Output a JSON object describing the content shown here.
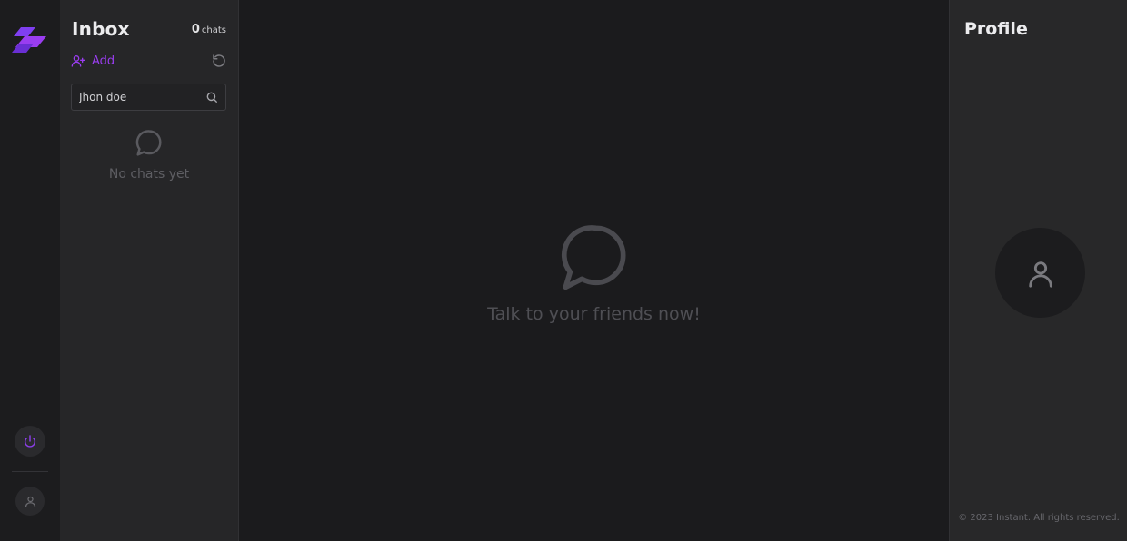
{
  "colors": {
    "accent": "#9a3df0",
    "rail_bg": "#1c1c1e",
    "panel_bg": "#262628",
    "main_bg": "#1b1b1d",
    "profile_bg": "#282829"
  },
  "rail": {
    "logo_icon": "brand-logo-icon",
    "power_icon": "power-icon",
    "avatar_icon": "user-icon"
  },
  "inbox": {
    "title": "Inbox",
    "count": "0",
    "count_label": "chats",
    "add_label": "Add",
    "add_icon": "user-plus-icon",
    "refresh_icon": "refresh-icon",
    "search": {
      "value": "Jhon doe",
      "icon": "search-icon"
    },
    "empty_text": "No chats yet",
    "empty_icon": "chat-bubble-icon"
  },
  "main": {
    "empty_text": "Talk to your friends now!",
    "empty_icon": "chat-bubble-icon"
  },
  "profile": {
    "title": "Profile",
    "avatar_icon": "user-icon",
    "footer": "© 2023 Instant. All rights reserved."
  }
}
